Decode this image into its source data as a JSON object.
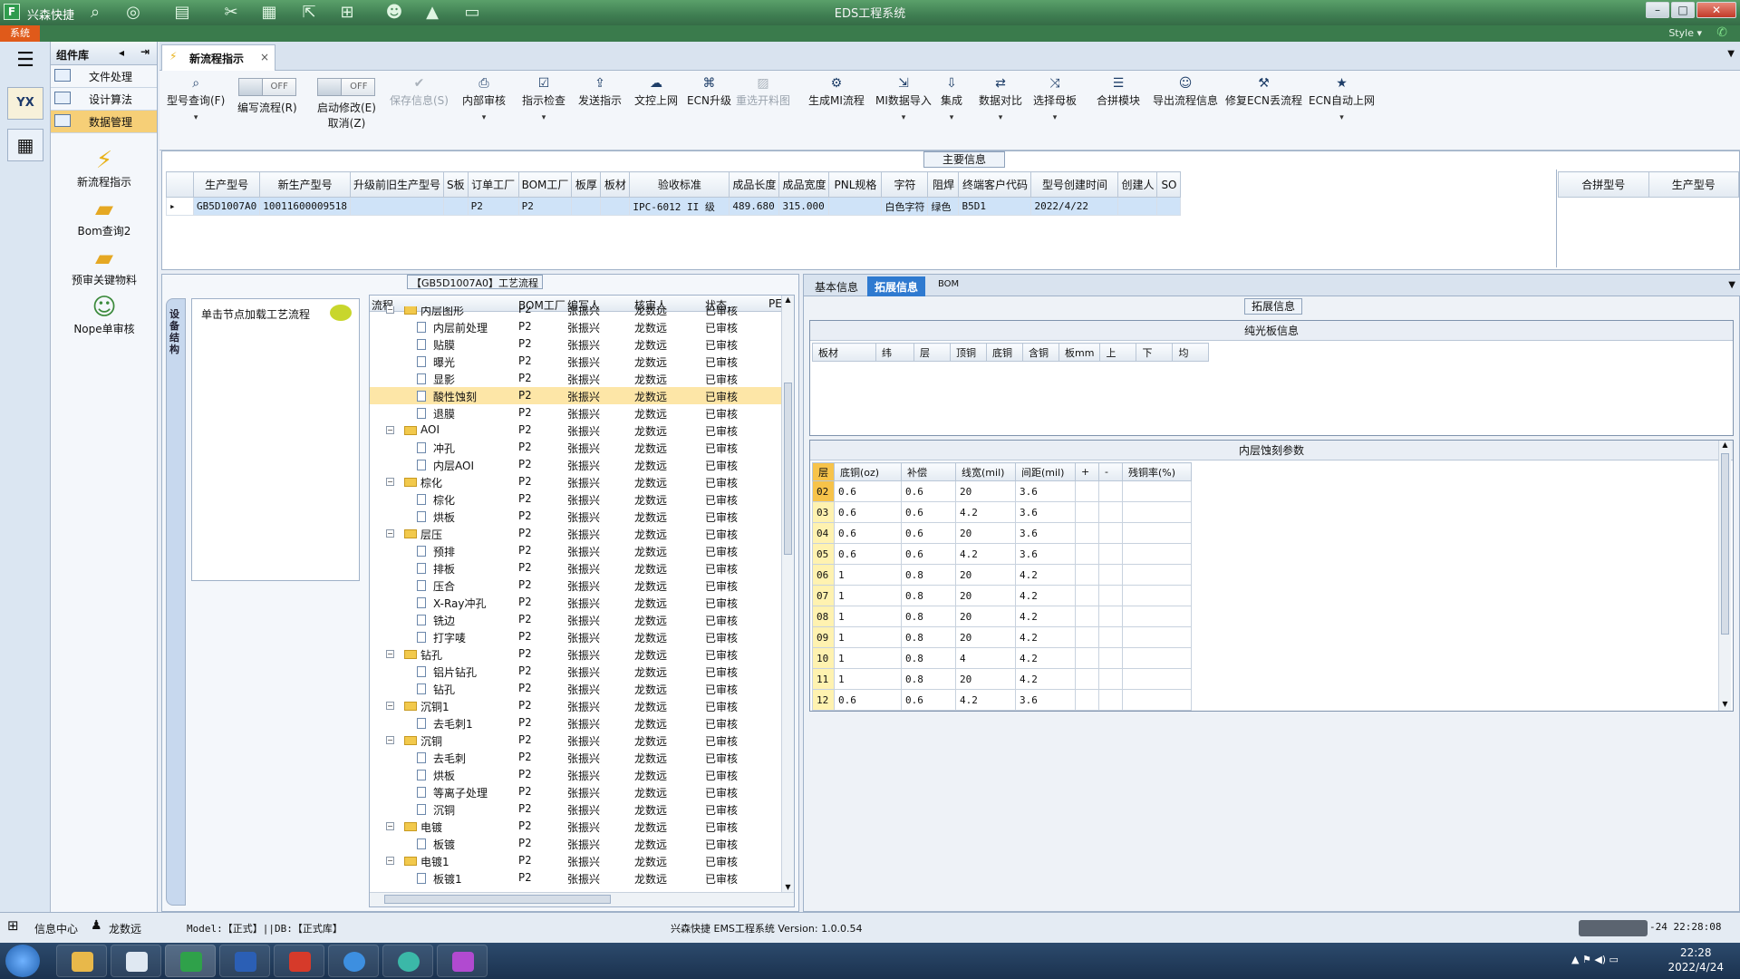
{
  "window": {
    "app_name": "兴森快捷",
    "title": "EDS工程系统",
    "style_label": "Style",
    "system_tab": "系统",
    "buttons": [
      "–",
      "□",
      "✕"
    ]
  },
  "rail": {
    "logo": "YX"
  },
  "component_panel": {
    "title": "组件库",
    "items": [
      {
        "label": "文件处理",
        "selected": false
      },
      {
        "label": "设计算法",
        "selected": false
      },
      {
        "label": "数据管理",
        "selected": true
      }
    ],
    "launchers": [
      {
        "label": "新流程指示",
        "icon": "lightning-icon"
      },
      {
        "label": "Bom查询2",
        "icon": "folder-icon"
      },
      {
        "label": "预审关键物料",
        "icon": "folder-icon"
      },
      {
        "label": "Nope单审核",
        "icon": "user-icon"
      }
    ]
  },
  "doc_tab": {
    "label": "新流程指示",
    "close": "×"
  },
  "toolbar": {
    "buttons": [
      {
        "label": "型号查询(F)",
        "icon": "search-icon",
        "dropdown": true,
        "disabled": false
      },
      {
        "label": "编写流程(R)",
        "toggle": "OFF",
        "disabled": false
      },
      {
        "label": "启动修改(E)",
        "label2": "取消(Z)",
        "toggle": "OFF",
        "disabled": false
      },
      {
        "label": "保存信息(S)",
        "icon": "check-icon",
        "disabled": true
      },
      {
        "label": "内部审核",
        "icon": "print-icon",
        "dropdown": true,
        "disabled": false
      },
      {
        "label": "指示检查",
        "icon": "checkbox-icon",
        "dropdown": true,
        "disabled": false
      },
      {
        "label": "发送指示",
        "icon": "upload-icon",
        "disabled": false
      },
      {
        "label": "文控上网",
        "icon": "cloud-icon",
        "disabled": false
      },
      {
        "label": "ECN升级",
        "icon": "binoculars-icon",
        "disabled": false
      },
      {
        "label": "重选开料图",
        "icon": "image-icon",
        "disabled": true
      },
      {
        "label": "生成MI流程",
        "icon": "gears-icon",
        "disabled": false
      },
      {
        "label": "MI数据导入",
        "icon": "import-icon",
        "dropdown": true,
        "disabled": false
      },
      {
        "label": "集成",
        "icon": "download-icon",
        "dropdown": true,
        "disabled": false
      },
      {
        "label": "数据对比",
        "icon": "compare-icon",
        "dropdown": true,
        "disabled": false
      },
      {
        "label": "选择母板",
        "icon": "shuffle-icon",
        "dropdown": true,
        "disabled": false
      },
      {
        "label": "合拼模块",
        "icon": "list-icon",
        "disabled": false
      },
      {
        "label": "导出流程信息",
        "icon": "smile-icon",
        "disabled": false
      },
      {
        "label": "修复ECN丢流程",
        "icon": "wrench-icon",
        "disabled": false
      },
      {
        "label": "ECN自动上网",
        "icon": "star-icon",
        "dropdown": true,
        "disabled": false
      }
    ]
  },
  "main_info": {
    "caption": "主要信息",
    "columns": [
      "生产型号",
      "新生产型号",
      "升级前旧生产型号",
      "S板",
      "订单工厂",
      "BOM工厂",
      "板厚",
      "板材",
      "验收标准",
      "成品长度",
      "成品宽度",
      "PNL规格",
      "字符",
      "阻焊",
      "终端客户代码",
      "型号创建时间",
      "创建人",
      "SO"
    ],
    "rows": [
      [
        "GB5D1007A0",
        "10011600009518",
        "",
        "",
        "P2",
        "P2",
        "",
        "",
        "IPC-6012 II 级",
        "489.680",
        "315.000",
        "",
        "白色字符",
        "绿色",
        "B5D1",
        "2022/4/22",
        "",
        ""
      ]
    ],
    "merge_columns": [
      "合拼型号",
      "生产型号"
    ]
  },
  "process": {
    "caption": "【GB5D1007A0】工艺流程",
    "side_tab": "设备结构",
    "hint": "单击节点加载工艺流程",
    "columns": [
      "流程",
      "BOM工厂",
      "编写人",
      "核审人",
      "状态",
      "PE"
    ],
    "rows": [
      {
        "level": 0,
        "label": "内层图形",
        "folder": true,
        "factory": "P2",
        "writer": "张振兴",
        "checker": "龙数远",
        "status": "已审核"
      },
      {
        "level": 1,
        "label": "内层前处理",
        "folder": false,
        "factory": "P2",
        "writer": "张振兴",
        "checker": "龙数远",
        "status": "已审核"
      },
      {
        "level": 1,
        "label": "贴膜",
        "folder": false,
        "factory": "P2",
        "writer": "张振兴",
        "checker": "龙数远",
        "status": "已审核"
      },
      {
        "level": 1,
        "label": "曝光",
        "folder": false,
        "factory": "P2",
        "writer": "张振兴",
        "checker": "龙数远",
        "status": "已审核"
      },
      {
        "level": 1,
        "label": "显影",
        "folder": false,
        "factory": "P2",
        "writer": "张振兴",
        "checker": "龙数远",
        "status": "已审核"
      },
      {
        "level": 1,
        "label": "酸性蚀刻",
        "folder": false,
        "factory": "P2",
        "writer": "张振兴",
        "checker": "龙数远",
        "status": "已审核",
        "highlight": true
      },
      {
        "level": 1,
        "label": "退膜",
        "folder": false,
        "factory": "P2",
        "writer": "张振兴",
        "checker": "龙数远",
        "status": "已审核"
      },
      {
        "level": 0,
        "label": "AOI",
        "folder": true,
        "factory": "P2",
        "writer": "张振兴",
        "checker": "龙数远",
        "status": "已审核"
      },
      {
        "level": 1,
        "label": "冲孔",
        "folder": false,
        "factory": "P2",
        "writer": "张振兴",
        "checker": "龙数远",
        "status": "已审核"
      },
      {
        "level": 1,
        "label": "内层AOI",
        "folder": false,
        "factory": "P2",
        "writer": "张振兴",
        "checker": "龙数远",
        "status": "已审核"
      },
      {
        "level": 0,
        "label": "棕化",
        "folder": true,
        "factory": "P2",
        "writer": "张振兴",
        "checker": "龙数远",
        "status": "已审核"
      },
      {
        "level": 1,
        "label": "棕化",
        "folder": false,
        "factory": "P2",
        "writer": "张振兴",
        "checker": "龙数远",
        "status": "已审核"
      },
      {
        "level": 1,
        "label": "烘板",
        "folder": false,
        "factory": "P2",
        "writer": "张振兴",
        "checker": "龙数远",
        "status": "已审核"
      },
      {
        "level": 0,
        "label": "层压",
        "folder": true,
        "factory": "P2",
        "writer": "张振兴",
        "checker": "龙数远",
        "status": "已审核"
      },
      {
        "level": 1,
        "label": "预排",
        "folder": false,
        "factory": "P2",
        "writer": "张振兴",
        "checker": "龙数远",
        "status": "已审核"
      },
      {
        "level": 1,
        "label": "排板",
        "folder": false,
        "factory": "P2",
        "writer": "张振兴",
        "checker": "龙数远",
        "status": "已审核"
      },
      {
        "level": 1,
        "label": "压合",
        "folder": false,
        "factory": "P2",
        "writer": "张振兴",
        "checker": "龙数远",
        "status": "已审核"
      },
      {
        "level": 1,
        "label": "X-Ray冲孔",
        "folder": false,
        "factory": "P2",
        "writer": "张振兴",
        "checker": "龙数远",
        "status": "已审核"
      },
      {
        "level": 1,
        "label": "铣边",
        "folder": false,
        "factory": "P2",
        "writer": "张振兴",
        "checker": "龙数远",
        "status": "已审核"
      },
      {
        "level": 1,
        "label": "打字唛",
        "folder": false,
        "factory": "P2",
        "writer": "张振兴",
        "checker": "龙数远",
        "status": "已审核"
      },
      {
        "level": 0,
        "label": "钻孔",
        "folder": true,
        "factory": "P2",
        "writer": "张振兴",
        "checker": "龙数远",
        "status": "已审核"
      },
      {
        "level": 1,
        "label": "铝片钻孔",
        "folder": false,
        "factory": "P2",
        "writer": "张振兴",
        "checker": "龙数远",
        "status": "已审核"
      },
      {
        "level": 1,
        "label": "钻孔",
        "folder": false,
        "factory": "P2",
        "writer": "张振兴",
        "checker": "龙数远",
        "status": "已审核"
      },
      {
        "level": 0,
        "label": "沉铜1",
        "folder": true,
        "factory": "P2",
        "writer": "张振兴",
        "checker": "龙数远",
        "status": "已审核"
      },
      {
        "level": 1,
        "label": "去毛刺1",
        "folder": false,
        "factory": "P2",
        "writer": "张振兴",
        "checker": "龙数远",
        "status": "已审核"
      },
      {
        "level": 0,
        "label": "沉铜",
        "folder": true,
        "factory": "P2",
        "writer": "张振兴",
        "checker": "龙数远",
        "status": "已审核"
      },
      {
        "level": 1,
        "label": "去毛刺",
        "folder": false,
        "factory": "P2",
        "writer": "张振兴",
        "checker": "龙数远",
        "status": "已审核"
      },
      {
        "level": 1,
        "label": "烘板",
        "folder": false,
        "factory": "P2",
        "writer": "张振兴",
        "checker": "龙数远",
        "status": "已审核"
      },
      {
        "level": 1,
        "label": "等离子处理",
        "folder": false,
        "factory": "P2",
        "writer": "张振兴",
        "checker": "龙数远",
        "status": "已审核"
      },
      {
        "level": 1,
        "label": "沉铜",
        "folder": false,
        "factory": "P2",
        "writer": "张振兴",
        "checker": "龙数远",
        "status": "已审核"
      },
      {
        "level": 0,
        "label": "电镀",
        "folder": true,
        "factory": "P2",
        "writer": "张振兴",
        "checker": "龙数远",
        "status": "已审核"
      },
      {
        "level": 1,
        "label": "板镀",
        "folder": false,
        "factory": "P2",
        "writer": "张振兴",
        "checker": "龙数远",
        "status": "已审核"
      },
      {
        "level": 0,
        "label": "电镀1",
        "folder": true,
        "factory": "P2",
        "writer": "张振兴",
        "checker": "龙数远",
        "status": "已审核"
      },
      {
        "level": 1,
        "label": "板镀1",
        "folder": false,
        "factory": "P2",
        "writer": "张振兴",
        "checker": "龙数远",
        "status": "已审核"
      }
    ]
  },
  "right": {
    "tabs": [
      {
        "label": "基本信息",
        "selected": false
      },
      {
        "label": "拓展信息",
        "selected": true
      },
      {
        "label": "BOM",
        "selected": false
      }
    ],
    "caption": "拓展信息",
    "pure_panel": {
      "title": "纯光板信息",
      "columns": [
        "板材",
        "纬",
        "层",
        "顶铜",
        "底铜",
        "含铜",
        "板mm",
        "上",
        "下",
        "均"
      ]
    },
    "inner_panel": {
      "title": "内层蚀刻参数",
      "columns": [
        "层",
        "底铜(oz)",
        "补偿",
        "线宽(mil)",
        "间距(mil)",
        "+",
        "-",
        "残铜率(%)"
      ],
      "rows": [
        [
          "02",
          "0.6",
          "0.6",
          "20",
          "3.6",
          "",
          "",
          ""
        ],
        [
          "03",
          "0.6",
          "0.6",
          "4.2",
          "3.6",
          "",
          "",
          ""
        ],
        [
          "04",
          "0.6",
          "0.6",
          "20",
          "3.6",
          "",
          "",
          ""
        ],
        [
          "05",
          "0.6",
          "0.6",
          "4.2",
          "3.6",
          "",
          "",
          ""
        ],
        [
          "06",
          "1",
          "0.8",
          "20",
          "4.2",
          "",
          "",
          ""
        ],
        [
          "07",
          "1",
          "0.8",
          "20",
          "4.2",
          "",
          "",
          ""
        ],
        [
          "08",
          "1",
          "0.8",
          "20",
          "4.2",
          "",
          "",
          ""
        ],
        [
          "09",
          "1",
          "0.8",
          "20",
          "4.2",
          "",
          "",
          ""
        ],
        [
          "10",
          "1",
          "0.8",
          "4",
          "4.2",
          "",
          "",
          ""
        ],
        [
          "11",
          "1",
          "0.8",
          "20",
          "4.2",
          "",
          "",
          ""
        ],
        [
          "12",
          "0.6",
          "0.6",
          "4.2",
          "3.6",
          "",
          "",
          ""
        ]
      ]
    }
  },
  "status_bar": {
    "info_center": "信息中心",
    "user": "龙数远",
    "model": "Model:【正式】||DB:【正式库】",
    "version": "兴森快捷  EMS工程系统  Version: 1.0.0.54",
    "datetime": "-24 22:28:08"
  },
  "taskbar": {
    "time": "22:28",
    "date": "2022/4/24"
  }
}
